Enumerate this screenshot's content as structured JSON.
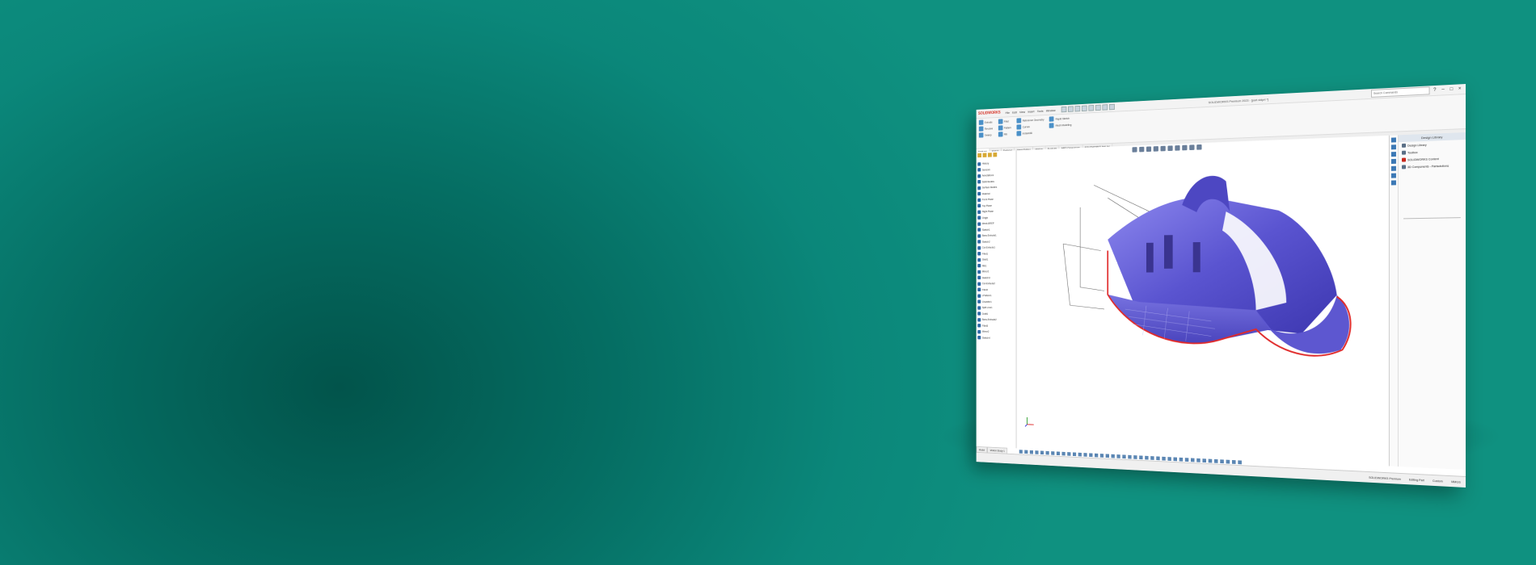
{
  "app": {
    "brand": "SOLIDWORKS",
    "document_title": "SOLIDWORKS Premium 2023 - [part.sldprt *]",
    "menu": [
      "File",
      "Edit",
      "View",
      "Insert",
      "Tools",
      "Window"
    ],
    "search_placeholder": "Search Commands"
  },
  "ribbon": {
    "groups": [
      [
        "Extrude",
        "Revolve",
        "Sweep"
      ],
      [
        "Fillet",
        "Pattern",
        "Rib"
      ],
      [
        "Reference Geometry",
        "Curves",
        "Instant3D"
      ],
      [
        "Rapid Sketch",
        "Mesh Modeling"
      ]
    ]
  },
  "tabs": [
    "Features",
    "Sketch",
    "Surfaces",
    "Direct Editing",
    "Markup",
    "Evaluate",
    "MBD Dimensions",
    "SOLIDWORKS Add-Ins"
  ],
  "feature_tree": [
    "History",
    "Sensors",
    "Annotations",
    "Solid Bodies",
    "Surface Bodies",
    "Material",
    "Front Plane",
    "Top Plane",
    "Right Plane",
    "Origin",
    "Mesh-BREP",
    "Sketch1",
    "Boss-Extrude1",
    "Sketch2",
    "Cut-Extrude1",
    "Fillet1",
    "Shell1",
    "Rib1",
    "Mirror1",
    "Sketch3",
    "Cut-Extrude2",
    "Fillet2",
    "LPattern1",
    "Chamfer1",
    "Split Line1",
    "Draft1",
    "Boss-Extrude2",
    "Fillet3",
    "Mirror2",
    "Sketch4"
  ],
  "bottom_tabs": [
    "Model",
    "Motion Study 1"
  ],
  "task_pane": {
    "title": "Design Library",
    "items": [
      {
        "label": "Design Library",
        "icon": "library-icon"
      },
      {
        "label": "Toolbox",
        "icon": "toolbox-icon"
      },
      {
        "label": "SOLIDWORKS Content",
        "icon": "sw-content-icon",
        "red": true
      },
      {
        "label": "3D Components - Partsolutions",
        "icon": "3d-components-icon"
      }
    ]
  },
  "status": [
    "SOLIDWORKS Premium",
    "Editing Part",
    "Custom",
    "MMGS"
  ],
  "colors": {
    "background_dark": "#02544b",
    "background_light": "#0f9180",
    "model_fill": "#6a64d8",
    "section_outline": "#e02a2a"
  }
}
